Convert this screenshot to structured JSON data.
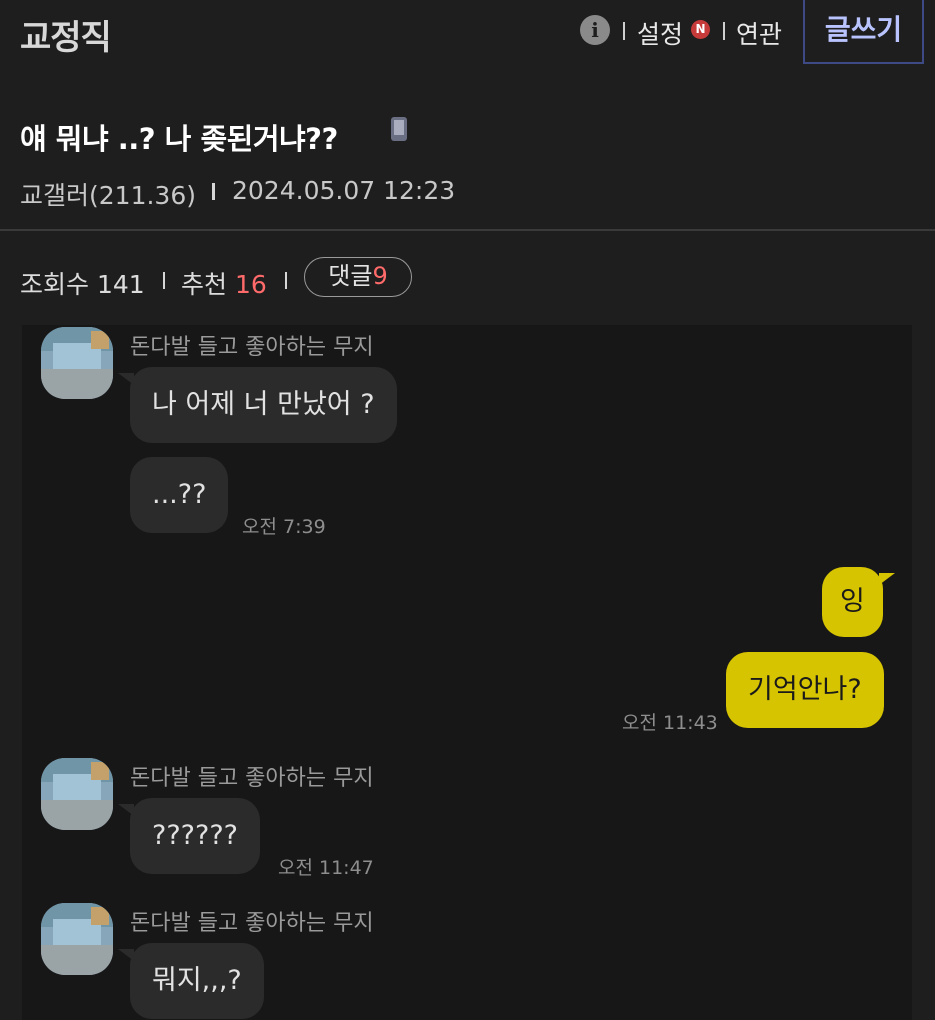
{
  "header": {
    "board_title": "교정직",
    "info_icon": "info-icon",
    "settings_label": "설정",
    "new_badge": "N",
    "related_label": "연관",
    "write_button": "글쓰기"
  },
  "post": {
    "title": "얘 뭐냐 ..? 나 좆된거냐??",
    "device_icon": "mobile-icon",
    "author": "교갤러(211.36)",
    "datetime": "2024.05.07 12:23",
    "views_label": "조회수",
    "views": "141",
    "recommend_label": "추천",
    "recommend": "16",
    "comments_label": "댓글",
    "comments": "9"
  },
  "chat": {
    "messages": [
      {
        "sender": "돈다발 들고 좋아하는 무지",
        "text": "나 어제 너 만났어 ?"
      },
      {
        "text": "...??",
        "time": "오전 7:39"
      },
      {
        "text": "잉"
      },
      {
        "text": "기억안나?",
        "time": "오전 11:43"
      },
      {
        "sender": "돈다발 들고 좋아하는 무지",
        "text": "??????",
        "time": "오전 11:47"
      },
      {
        "sender": "돈다발 들고 좋아하는 무지",
        "text": "뭐지,,,?"
      }
    ]
  },
  "colors": {
    "background": "#1e1e1e",
    "write_button_border": "#3d4a86",
    "recommend_count": "#ff6a6a",
    "my_bubble": "#d7c400",
    "other_bubble": "#2b2b2b"
  }
}
